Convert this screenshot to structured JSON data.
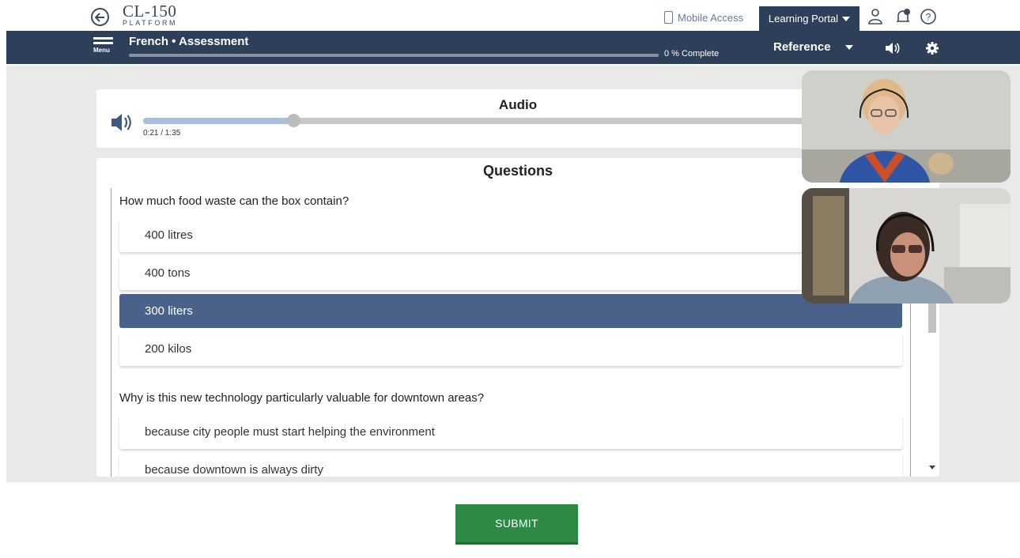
{
  "topbar": {
    "logo_line1": "CL-150",
    "logo_line2": "PLATFORM",
    "mobile_access": "Mobile Access",
    "learning_portal": "Learning Portal"
  },
  "header": {
    "menu_label": "Menu",
    "course_title": "French • Assessment",
    "progress_percent": 0,
    "progress_text": "0 % Complete",
    "reference_label": "Reference"
  },
  "audio": {
    "title": "Audio",
    "time": "0:21 / 1:35",
    "progress_fraction": 0.221
  },
  "questions": {
    "title": "Questions",
    "items": [
      {
        "prompt": "How much food waste can the box contain?",
        "options": [
          "400 litres",
          "400 tons",
          "300 liters",
          "200 kilos"
        ],
        "selected_index": 2
      },
      {
        "prompt": "Why is this new technology particularly valuable for downtown areas?",
        "options": [
          "because city people must start helping the environment",
          "because downtown is always dirty"
        ]
      }
    ]
  },
  "submit_label": "SUBMIT",
  "colors": {
    "header_bg": "#2e4059",
    "selected_option": "#4a6189",
    "submit_bg": "#2c8a45"
  }
}
